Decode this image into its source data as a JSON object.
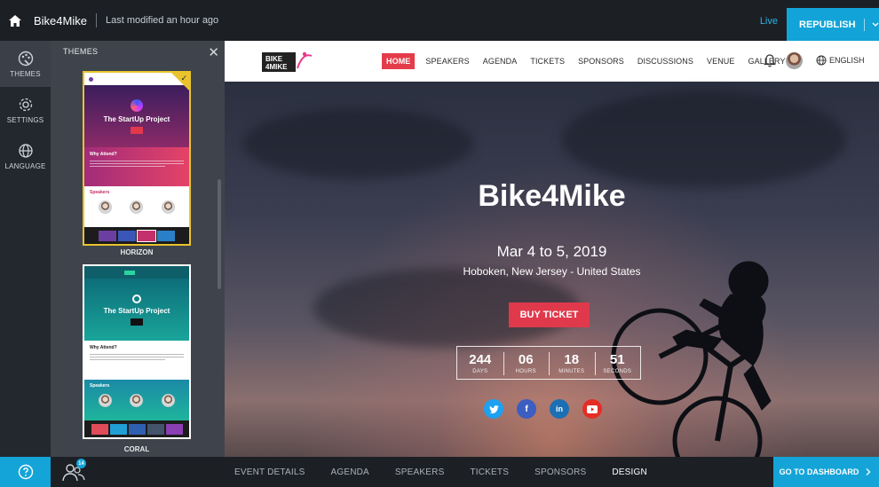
{
  "topbar": {
    "app_name": "Bike4Mike",
    "last_modified": "Last modified an hour ago",
    "live_label": "Live",
    "republish_label": "REPUBLISH"
  },
  "rail": {
    "items": [
      {
        "label": "THEMES"
      },
      {
        "label": "SETTINGS"
      },
      {
        "label": "LANGUAGE"
      }
    ]
  },
  "themes_panel": {
    "title": "THEMES",
    "themes": [
      {
        "name": "HORIZON",
        "preview_title": "The StartUp Project",
        "preview_why": "Why Attend?",
        "preview_speakers": "Speakers",
        "swatches": [
          "#6b3fa0",
          "#3a56b8",
          "#c4306b",
          "#2a7fc9"
        ]
      },
      {
        "name": "CORAL",
        "preview_title": "The StartUp Project",
        "preview_why": "Why Attend?",
        "preview_speakers": "Speakers",
        "swatches": [
          "#e04b5a",
          "#1f9fd6",
          "#2f5fb0",
          "#44546a",
          "#8a3fb3"
        ]
      }
    ]
  },
  "site": {
    "nav": {
      "items": [
        "HOME",
        "SPEAKERS",
        "AGENDA",
        "TICKETS",
        "SPONSORS",
        "DISCUSSIONS",
        "VENUE",
        "GALLERY"
      ],
      "language": "ENGLISH"
    },
    "logo_text": [
      "BIKE",
      "4MIKE"
    ],
    "hero": {
      "title": "Bike4Mike",
      "date": "Mar 4 to 5, 2019",
      "location": "Hoboken, New Jersey - United States",
      "buy_label": "BUY TICKET",
      "countdown": [
        {
          "value": "244",
          "label": "DAYS"
        },
        {
          "value": "06",
          "label": "HOURS"
        },
        {
          "value": "18",
          "label": "MINUTES"
        },
        {
          "value": "51",
          "label": "SECONDS"
        }
      ],
      "social": [
        "twitter",
        "facebook",
        "linkedin",
        "youtube"
      ]
    }
  },
  "bottombar": {
    "attendee_count": "14",
    "tabs": [
      "EVENT DETAILS",
      "AGENDA",
      "SPEAKERS",
      "TICKETS",
      "SPONSORS",
      "DESIGN"
    ],
    "active_tab": "DESIGN",
    "dashboard_label": "GO TO DASHBOARD"
  },
  "colors": {
    "accent": "#14a4d8",
    "brand_red": "#e0394c",
    "selected_theme_border": "#e8c32e"
  }
}
